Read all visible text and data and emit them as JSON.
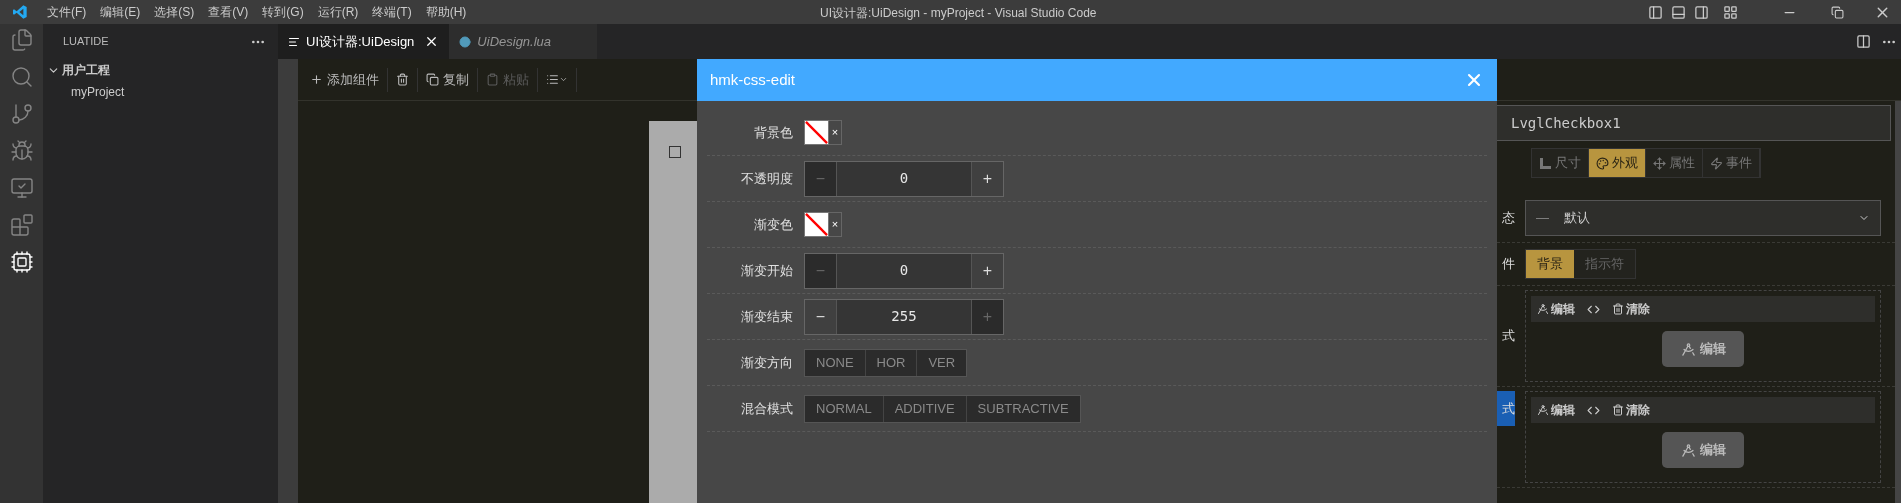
{
  "title_bar": {
    "menu": [
      "文件(F)",
      "编辑(E)",
      "选择(S)",
      "查看(V)",
      "转到(G)",
      "运行(R)",
      "终端(T)",
      "帮助(H)"
    ],
    "title": "UI设计器:UiDesign - myProject - Visual Studio Code"
  },
  "activity_bar": {
    "items": [
      {
        "selected": false
      },
      {
        "selected": false
      },
      {
        "selected": false
      },
      {
        "selected": false
      },
      {
        "selected": false
      },
      {
        "selected": false
      },
      {
        "selected": true
      }
    ]
  },
  "sidebar": {
    "title": "LUATIDE",
    "tree": [
      {
        "label": "用户工程",
        "expanded": true,
        "children": [
          {
            "label": "myProject"
          }
        ]
      }
    ]
  },
  "tabs": [
    {
      "label": "UI设计器:UiDesign",
      "selected": true,
      "preview": false
    },
    {
      "label": "UiDesign.lua",
      "selected": false,
      "preview": true
    }
  ],
  "toolbar": {
    "items": [
      {
        "kind": "add",
        "label": "添加组件",
        "disabled": false
      },
      {
        "kind": "delete",
        "disabled": false
      },
      {
        "kind": "copy",
        "label": "复制",
        "disabled": false
      },
      {
        "kind": "paste",
        "label": "粘贴",
        "disabled": true
      },
      {
        "kind": "menu",
        "disabled": false
      }
    ]
  },
  "canvas": {
    "checkbox": {
      "checked": false
    }
  },
  "dialog": {
    "title": "hmk-css-edit",
    "rows": [
      {
        "kind": "color",
        "label": "背景色",
        "clear": "×"
      },
      {
        "kind": "stepper",
        "label": "不透明度",
        "value": "0",
        "minus": "−",
        "plus": "+",
        "minus_disabled": true,
        "plus_disabled": false
      },
      {
        "kind": "color",
        "label": "渐变色",
        "clear": "×"
      },
      {
        "kind": "stepper",
        "label": "渐变开始",
        "value": "0",
        "minus": "−",
        "plus": "+",
        "minus_disabled": true,
        "plus_disabled": false
      },
      {
        "kind": "stepper",
        "label": "渐变结束",
        "value": "255",
        "minus": "−",
        "plus": "+",
        "minus_disabled": false,
        "plus_disabled": true
      },
      {
        "kind": "segmented",
        "label": "渐变方向",
        "options": [
          "NONE",
          "HOR",
          "VER"
        ]
      },
      {
        "kind": "segmented",
        "label": "混合模式",
        "options": [
          "NORMAL",
          "ADDITIVE",
          "SUBTRACTIVE"
        ]
      }
    ]
  },
  "properties": {
    "name": "LvglCheckbox1",
    "tabs": [
      {
        "label": "尺寸",
        "selected": false
      },
      {
        "label": "外观",
        "selected": true
      },
      {
        "label": "属性",
        "selected": false
      },
      {
        "label": "事件",
        "selected": false
      }
    ],
    "rows": [
      {
        "kind": "select",
        "label": "态",
        "marker": "—",
        "value": "默认",
        "highlighted": false
      },
      {
        "kind": "parts",
        "label": "件",
        "highlighted": false,
        "options": [
          {
            "label": "背景",
            "selected": true
          },
          {
            "label": "指示符",
            "selected": false
          }
        ]
      },
      {
        "kind": "style",
        "label": "式",
        "highlighted": false,
        "actions": [
          {
            "kind": "edit",
            "label": "编辑"
          },
          {
            "kind": "code"
          },
          {
            "kind": "clear",
            "label": "清除"
          }
        ],
        "button": "编辑"
      },
      {
        "kind": "style",
        "label": "式",
        "highlighted": true,
        "actions": [
          {
            "kind": "edit",
            "label": "编辑"
          },
          {
            "kind": "code"
          },
          {
            "kind": "clear",
            "label": "清除"
          }
        ],
        "button": "编辑"
      }
    ]
  }
}
